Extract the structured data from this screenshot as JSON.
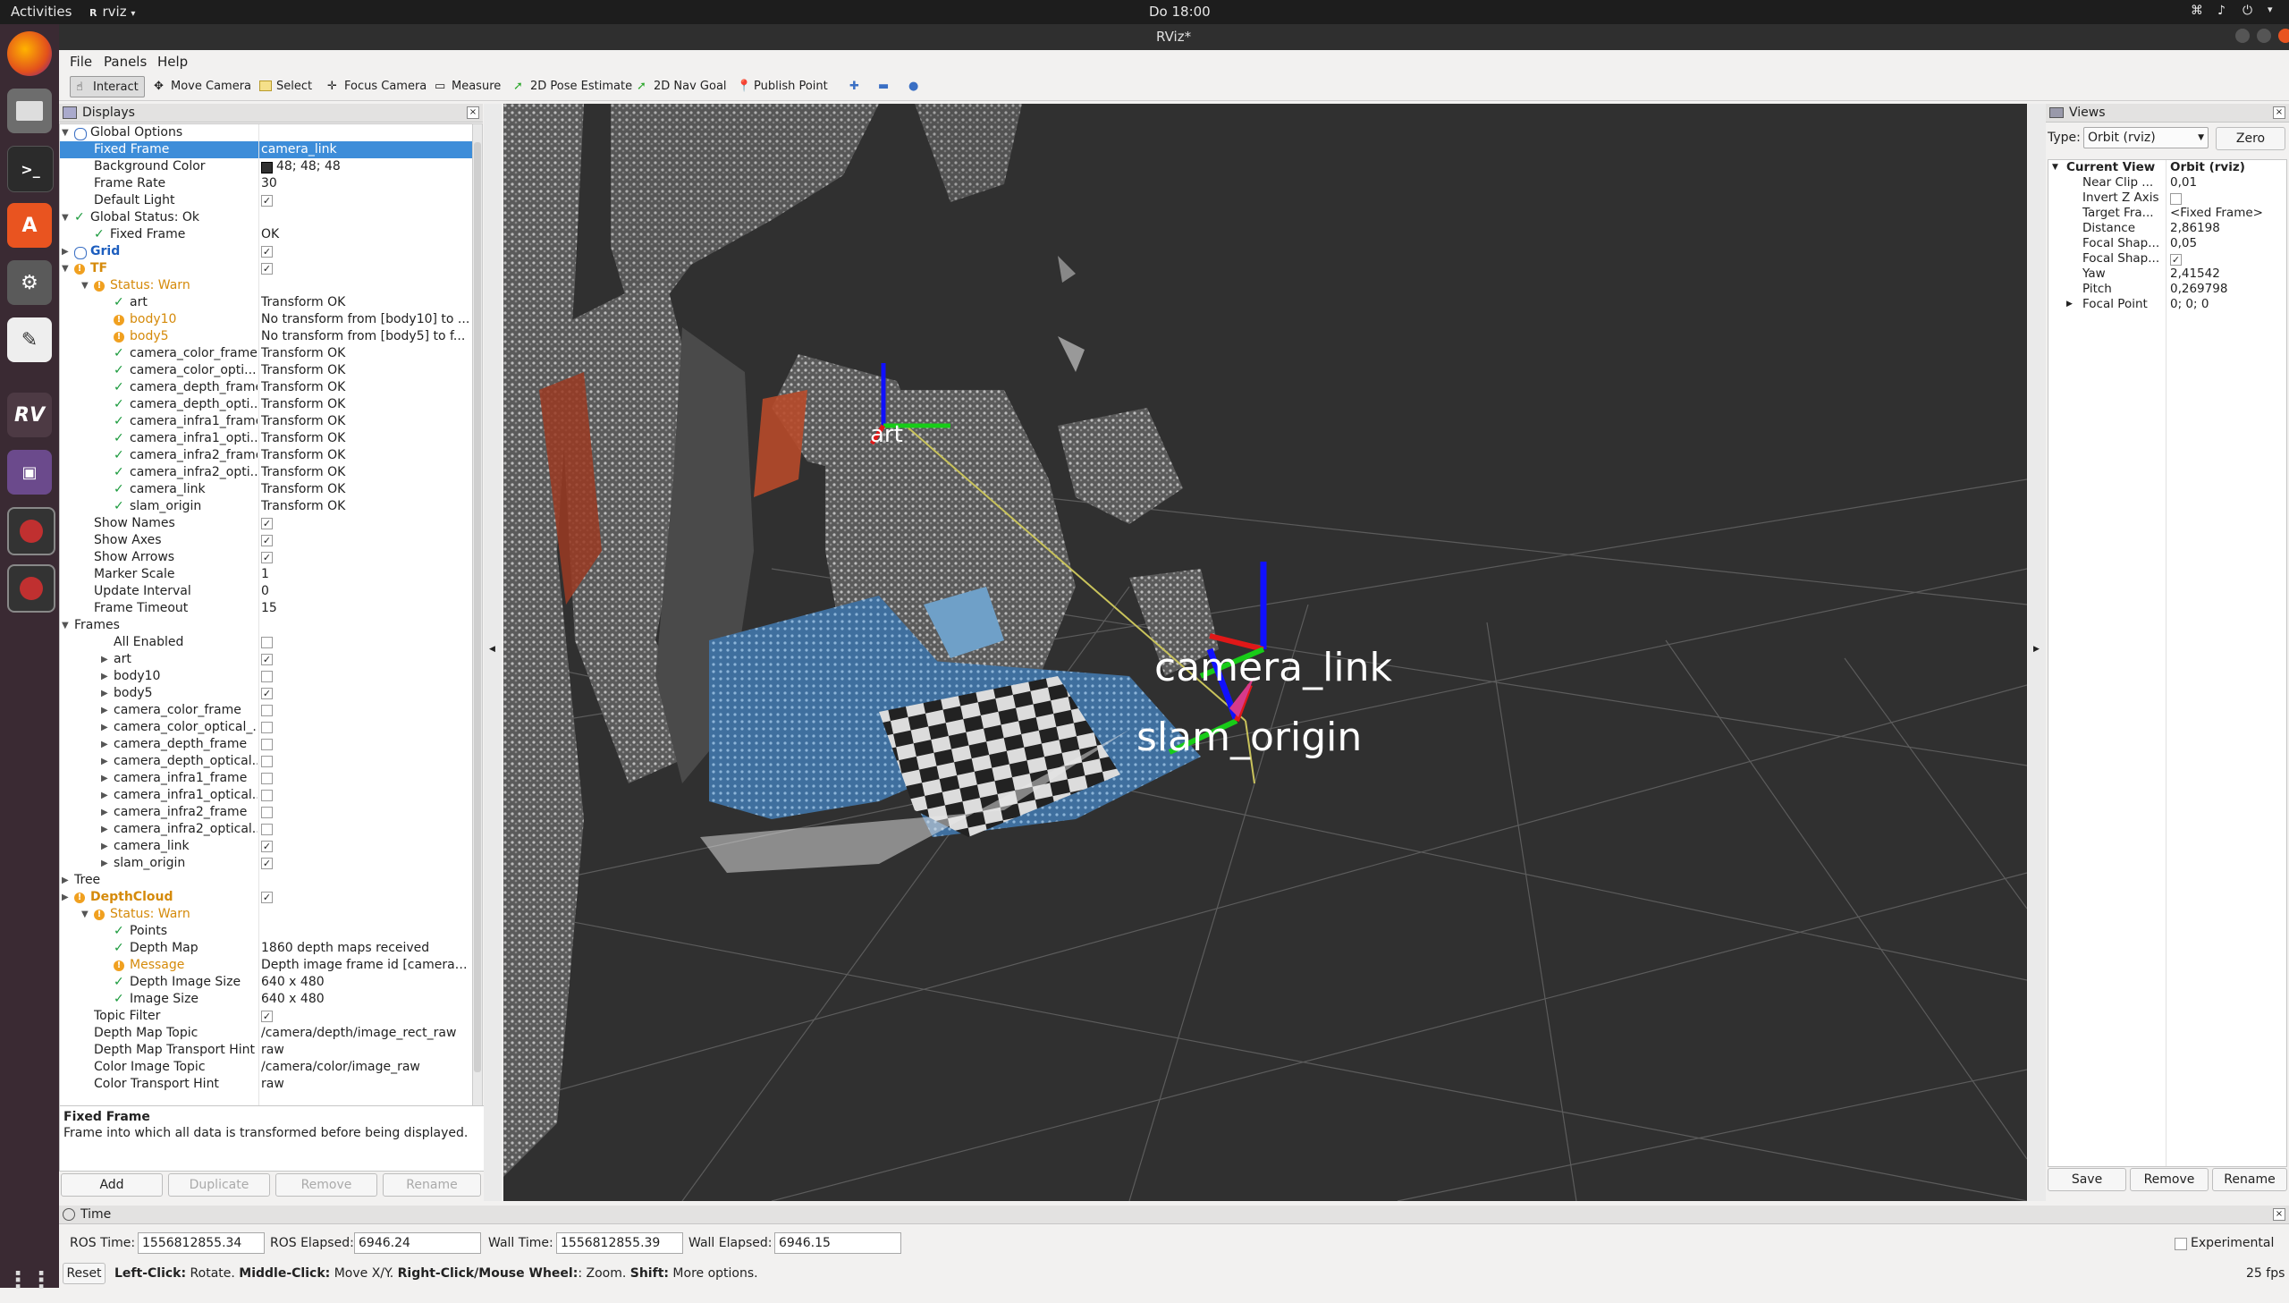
{
  "topbar": {
    "activities": "Activities",
    "app": "rviz",
    "clock": "Do 18:00"
  },
  "window": {
    "title": "RViz*"
  },
  "menu": [
    "File",
    "Panels",
    "Help"
  ],
  "toolbar": {
    "interact": "Interact",
    "move_camera": "Move Camera",
    "select": "Select",
    "focus_camera": "Focus Camera",
    "measure": "Measure",
    "pose_estimate": "2D Pose Estimate",
    "nav_goal": "2D Nav Goal",
    "publish_point": "Publish Point"
  },
  "displays": {
    "title": "Displays",
    "rows": [
      {
        "name": "Global Options",
        "value": "",
        "indent": 0,
        "icon": "gear",
        "arrow": "down"
      },
      {
        "name": "Fixed Frame",
        "value": "camera_link",
        "indent": 1,
        "selected": true
      },
      {
        "name": "Background Color",
        "value": "48; 48; 48",
        "indent": 1,
        "swatch": "#303030"
      },
      {
        "name": "Frame Rate",
        "value": "30",
        "indent": 1
      },
      {
        "name": "Default Light",
        "value": "",
        "indent": 1,
        "check": true
      },
      {
        "name": "Global Status: Ok",
        "value": "",
        "indent": 0,
        "status": "ok",
        "arrow": "down"
      },
      {
        "name": "Fixed Frame",
        "value": "OK",
        "indent": 1,
        "status": "ok"
      },
      {
        "name": "Grid",
        "value": "",
        "indent": 0,
        "icon": "grid",
        "check": true,
        "style": "blue",
        "arrow": "right"
      },
      {
        "name": "TF",
        "value": "",
        "indent": 0,
        "status": "warn",
        "check": true,
        "style": "warn",
        "arrow": "down"
      },
      {
        "name": "Status: Warn",
        "value": "",
        "indent": 1,
        "status": "warn",
        "style": "warn",
        "arrow": "down"
      },
      {
        "name": "art",
        "value": "Transform OK",
        "indent": 2,
        "status": "ok"
      },
      {
        "name": "body10",
        "value": "No transform from [body10] to ...",
        "indent": 2,
        "status": "warn",
        "style": "warn"
      },
      {
        "name": "body5",
        "value": "No transform from [body5] to f...",
        "indent": 2,
        "status": "warn",
        "style": "warn"
      },
      {
        "name": "camera_color_frame",
        "value": "Transform OK",
        "indent": 2,
        "status": "ok"
      },
      {
        "name": "camera_color_opti...",
        "value": "Transform OK",
        "indent": 2,
        "status": "ok"
      },
      {
        "name": "camera_depth_frame",
        "value": "Transform OK",
        "indent": 2,
        "status": "ok"
      },
      {
        "name": "camera_depth_opti...",
        "value": "Transform OK",
        "indent": 2,
        "status": "ok"
      },
      {
        "name": "camera_infra1_frame",
        "value": "Transform OK",
        "indent": 2,
        "status": "ok"
      },
      {
        "name": "camera_infra1_opti...",
        "value": "Transform OK",
        "indent": 2,
        "status": "ok"
      },
      {
        "name": "camera_infra2_frame",
        "value": "Transform OK",
        "indent": 2,
        "status": "ok"
      },
      {
        "name": "camera_infra2_opti...",
        "value": "Transform OK",
        "indent": 2,
        "status": "ok"
      },
      {
        "name": "camera_link",
        "value": "Transform OK",
        "indent": 2,
        "status": "ok"
      },
      {
        "name": "slam_origin",
        "value": "Transform OK",
        "indent": 2,
        "status": "ok"
      },
      {
        "name": "Show Names",
        "value": "",
        "indent": 1,
        "check": true
      },
      {
        "name": "Show Axes",
        "value": "",
        "indent": 1,
        "check": true
      },
      {
        "name": "Show Arrows",
        "value": "",
        "indent": 1,
        "check": true
      },
      {
        "name": "Marker Scale",
        "value": "1",
        "indent": 1
      },
      {
        "name": "Update Interval",
        "value": "0",
        "indent": 1
      },
      {
        "name": "Frame Timeout",
        "value": "15",
        "indent": 1
      },
      {
        "name": "Frames",
        "value": "",
        "indent": 0,
        "arrow": "down",
        "plain": true
      },
      {
        "name": "All Enabled",
        "value": "",
        "indent": 2,
        "check": false
      },
      {
        "name": "art",
        "value": "",
        "indent": 2,
        "check": true,
        "arrow": "right"
      },
      {
        "name": "body10",
        "value": "",
        "indent": 2,
        "check": false,
        "arrow": "right"
      },
      {
        "name": "body5",
        "value": "",
        "indent": 2,
        "check": true,
        "arrow": "right"
      },
      {
        "name": "camera_color_frame",
        "value": "",
        "indent": 2,
        "check": false,
        "arrow": "right"
      },
      {
        "name": "camera_color_optical_...",
        "value": "",
        "indent": 2,
        "check": false,
        "arrow": "right"
      },
      {
        "name": "camera_depth_frame",
        "value": "",
        "indent": 2,
        "check": false,
        "arrow": "right"
      },
      {
        "name": "camera_depth_optical...",
        "value": "",
        "indent": 2,
        "check": false,
        "arrow": "right"
      },
      {
        "name": "camera_infra1_frame",
        "value": "",
        "indent": 2,
        "check": false,
        "arrow": "right"
      },
      {
        "name": "camera_infra1_optical...",
        "value": "",
        "indent": 2,
        "check": false,
        "arrow": "right"
      },
      {
        "name": "camera_infra2_frame",
        "value": "",
        "indent": 2,
        "check": false,
        "arrow": "right"
      },
      {
        "name": "camera_infra2_optical...",
        "value": "",
        "indent": 2,
        "check": false,
        "arrow": "right"
      },
      {
        "name": "camera_link",
        "value": "",
        "indent": 2,
        "check": true,
        "arrow": "right"
      },
      {
        "name": "slam_origin",
        "value": "",
        "indent": 2,
        "check": true,
        "arrow": "right"
      },
      {
        "name": "Tree",
        "value": "",
        "indent": 0,
        "arrow": "right",
        "plain": true
      },
      {
        "name": "DepthCloud",
        "value": "",
        "indent": 0,
        "status": "warn",
        "check": true,
        "style": "warn",
        "arrow": "right"
      },
      {
        "name": "Status: Warn",
        "value": "",
        "indent": 1,
        "status": "warn",
        "style": "warn",
        "arrow": "down"
      },
      {
        "name": "Points",
        "value": "",
        "indent": 2,
        "status": "ok"
      },
      {
        "name": "Depth Map",
        "value": "1860 depth maps received",
        "indent": 2,
        "status": "ok"
      },
      {
        "name": "Message",
        "value": "Depth image frame id [camera_...",
        "indent": 2,
        "status": "warn",
        "style": "warn"
      },
      {
        "name": "Depth Image Size",
        "value": "640 x 480",
        "indent": 2,
        "status": "ok"
      },
      {
        "name": "Image Size",
        "value": "640 x 480",
        "indent": 2,
        "status": "ok"
      },
      {
        "name": "Topic Filter",
        "value": "",
        "indent": 1,
        "check": true
      },
      {
        "name": "Depth Map Topic",
        "value": "/camera/depth/image_rect_raw",
        "indent": 1
      },
      {
        "name": "Depth Map Transport Hint",
        "value": "raw",
        "indent": 1
      },
      {
        "name": "Color Image Topic",
        "value": "/camera/color/image_raw",
        "indent": 1
      },
      {
        "name": "Color Transport Hint",
        "value": "raw",
        "indent": 1
      }
    ],
    "description_title": "Fixed Frame",
    "description_text": "Frame into which all data is transformed before being displayed.",
    "buttons": {
      "add": "Add",
      "duplicate": "Duplicate",
      "remove": "Remove",
      "rename": "Rename"
    }
  },
  "viewport": {
    "labels": [
      "camera_link",
      "slam_origin",
      "art"
    ],
    "background": "#303030"
  },
  "views": {
    "title": "Views",
    "type_label": "Type:",
    "type_value": "Orbit (rviz)",
    "zero": "Zero",
    "current_view": "Current View",
    "current_view_value": "Orbit (rviz)",
    "rows": [
      {
        "name": "Near Clip ...",
        "value": "0,01"
      },
      {
        "name": "Invert Z Axis",
        "value": "",
        "check": false
      },
      {
        "name": "Target Fra...",
        "value": "<Fixed Frame>"
      },
      {
        "name": "Distance",
        "value": "2,86198"
      },
      {
        "name": "Focal Shap...",
        "value": "0,05"
      },
      {
        "name": "Focal Shap...",
        "value": "",
        "check": true
      },
      {
        "name": "Yaw",
        "value": "2,41542"
      },
      {
        "name": "Pitch",
        "value": "0,269798"
      },
      {
        "name": "Focal Point",
        "value": "0; 0; 0",
        "arrow": true
      }
    ],
    "buttons": {
      "save": "Save",
      "remove": "Remove",
      "rename": "Rename"
    }
  },
  "time": {
    "title": "Time",
    "ros_time_label": "ROS Time:",
    "ros_time": "1556812855.34",
    "ros_elapsed_label": "ROS Elapsed:",
    "ros_elapsed": "6946.24",
    "wall_time_label": "Wall Time:",
    "wall_time": "1556812855.39",
    "wall_elapsed_label": "Wall Elapsed:",
    "wall_elapsed": "6946.15",
    "experimental": "Experimental",
    "reset": "Reset",
    "hint_left_b": "Left-Click:",
    "hint_left": " Rotate. ",
    "hint_mid_b": "Middle-Click:",
    "hint_mid": " Move X/Y. ",
    "hint_right_b": "Right-Click/Mouse Wheel:",
    "hint_right": ": Zoom. ",
    "hint_shift_b": "Shift:",
    "hint_shift": " More options.",
    "fps": "25 fps"
  }
}
